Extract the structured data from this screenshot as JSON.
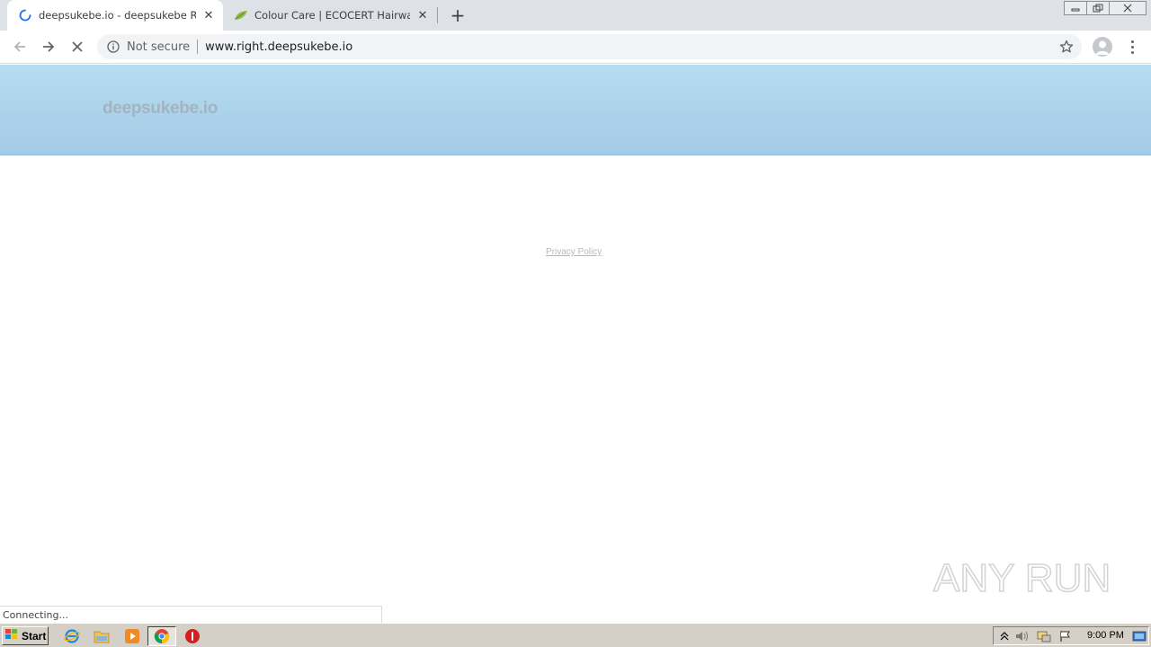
{
  "browser": {
    "tabs": [
      {
        "title": "deepsukebe.io - deepsukebe Resour",
        "state": "loading"
      },
      {
        "title": "Colour Care | ECOCERT Hairwash | N",
        "state": "idle"
      }
    ],
    "address_bar": {
      "security_label": "Not secure",
      "url": "www.right.deepsukebe.io"
    },
    "status_text": "Connecting..."
  },
  "page": {
    "logo_text": "deepsukebe.io",
    "footer_link": "Privacy Policy"
  },
  "watermark": {
    "text": "ANY RUN"
  },
  "taskbar": {
    "start_label": "Start",
    "clock": "9:00 PM"
  },
  "colors": {
    "header_gradient_top": "#b6dcf1",
    "header_gradient_bottom": "#a4cbe5",
    "tab_strip": "#dee1e6",
    "omnibox": "#f1f3f4",
    "taskbar": "#d4d0c8"
  }
}
